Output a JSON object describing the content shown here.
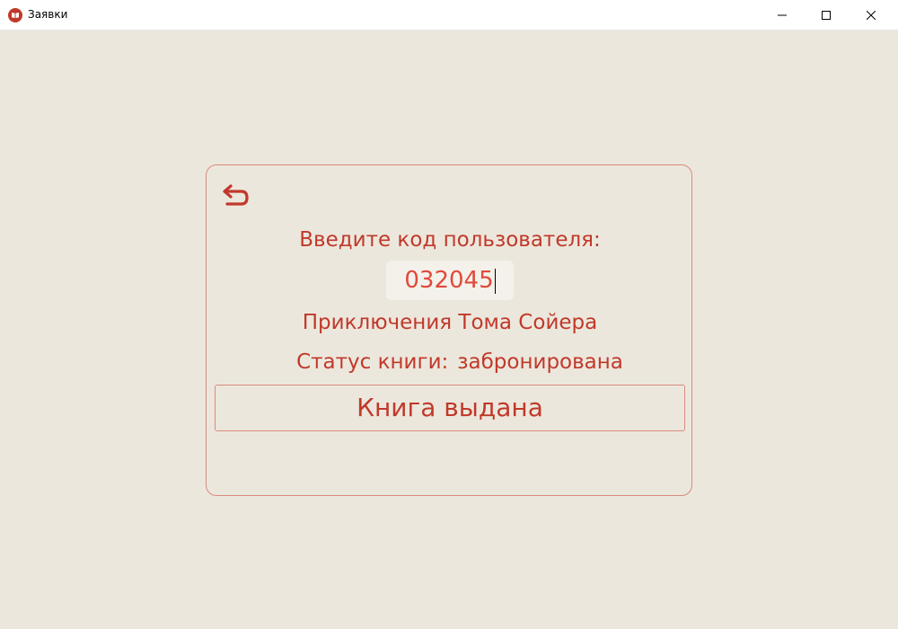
{
  "window": {
    "title": "Заявки",
    "app_icon": "book-icon"
  },
  "form": {
    "back_icon": "back-arrow-icon",
    "prompt": "Введите код пользователя:",
    "user_code": "032045",
    "book_title": "Приключения Тома Сойера",
    "status_label": "Статус книги:",
    "status_value": "забронирована",
    "issue_button": "Книга выдана"
  },
  "colors": {
    "background": "#ece7dc",
    "accent": "#c0392b",
    "border": "#d98a80"
  }
}
